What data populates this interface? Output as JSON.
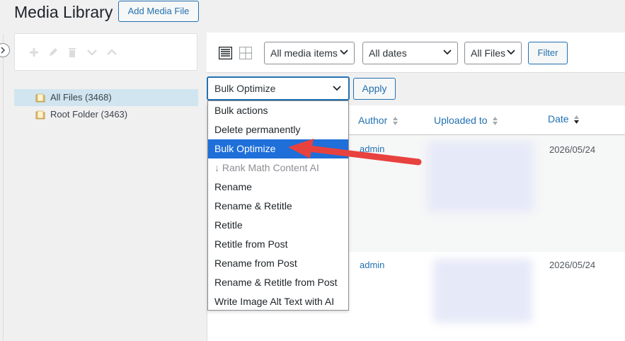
{
  "header": {
    "title": "Media Library",
    "add_button": "Add Media File"
  },
  "folders": {
    "items": [
      {
        "label": "All Files (3468)",
        "active": true
      },
      {
        "label": "Root Folder (3463)",
        "active": false
      }
    ]
  },
  "toolbar": {
    "media_filter": "All media items",
    "date_filter": "All dates",
    "files_filter": "All Files",
    "filter_button": "Filter"
  },
  "bulk": {
    "selected": "Bulk Optimize",
    "apply_button": "Apply",
    "options": [
      {
        "label": "Bulk actions"
      },
      {
        "label": "Delete permanently"
      },
      {
        "label": "Bulk Optimize",
        "selected": true
      },
      {
        "label": "↓ Rank Math Content AI",
        "disabled": true
      },
      {
        "label": "Rename"
      },
      {
        "label": "Rename & Retitle"
      },
      {
        "label": "Retitle"
      },
      {
        "label": "Retitle from Post"
      },
      {
        "label": "Rename from Post"
      },
      {
        "label": "Rename & Retitle from Post"
      },
      {
        "label": "Write Image Alt Text with AI"
      }
    ]
  },
  "table": {
    "columns": {
      "author": "Author",
      "uploaded_to": "Uploaded to",
      "date": "Date"
    },
    "rows": [
      {
        "author": "admin",
        "date": "2026/05/24"
      },
      {
        "author": "admin",
        "date": "2026/05/24"
      }
    ]
  },
  "colors": {
    "accent": "#2271b1",
    "selected_option": "#1e6fd9",
    "arrow": "#e8423f"
  }
}
